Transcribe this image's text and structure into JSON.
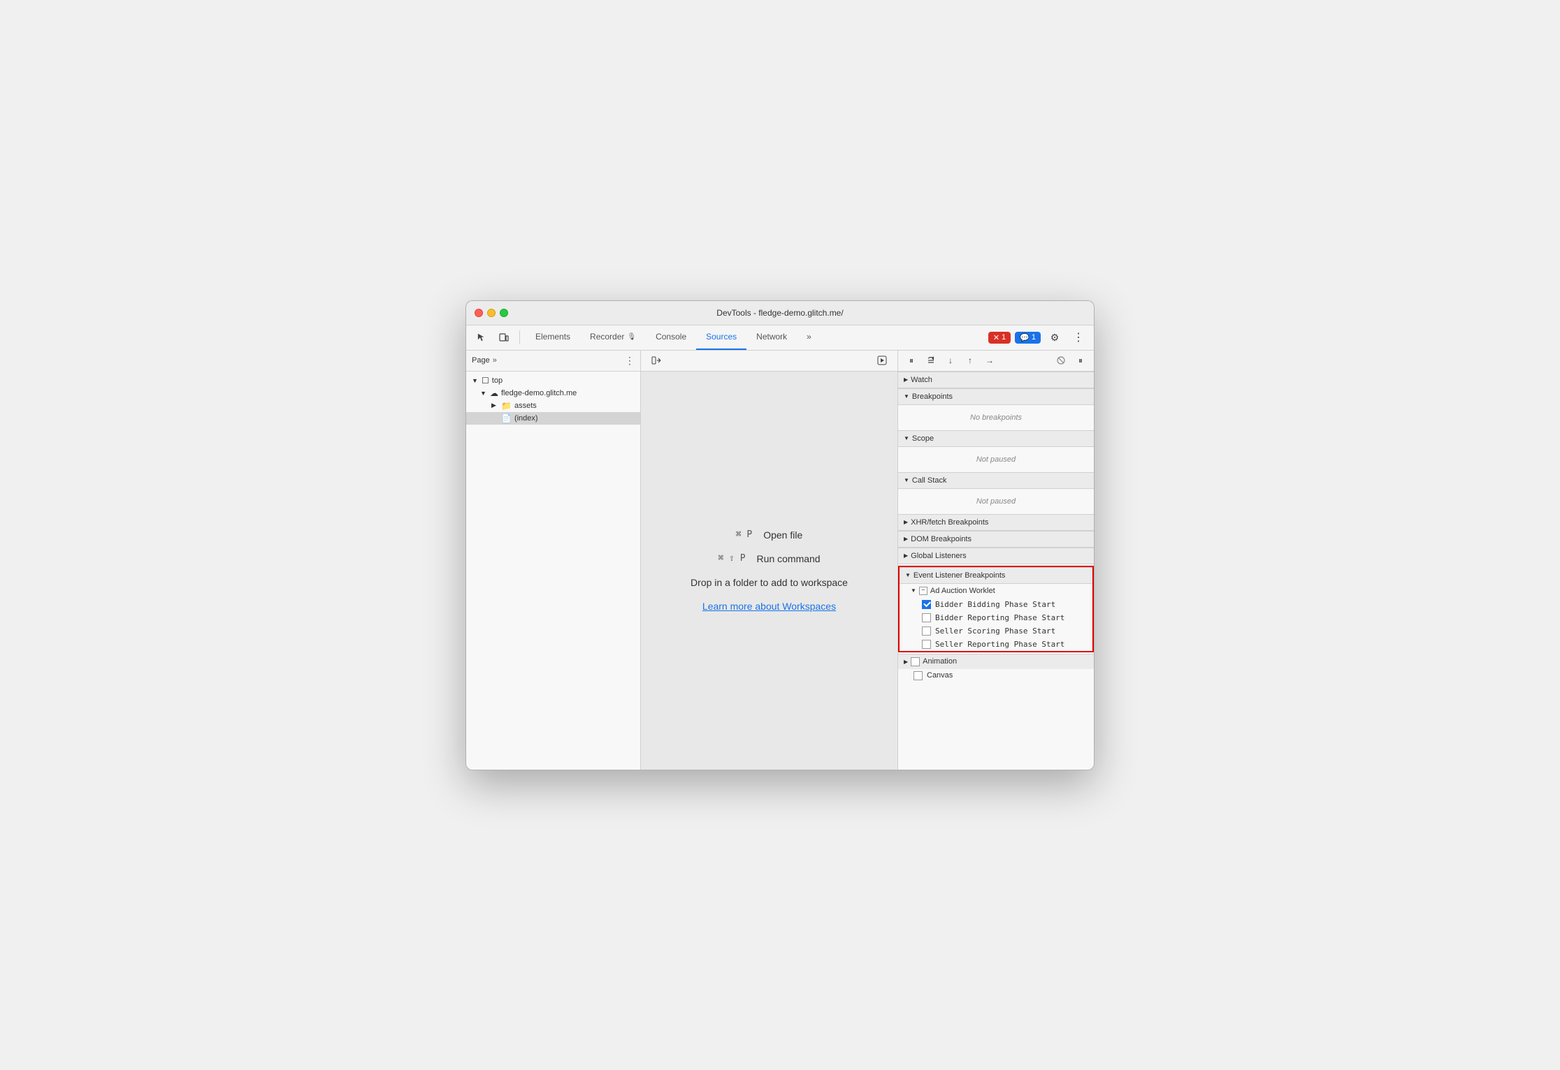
{
  "window": {
    "title": "DevTools - fledge-demo.glitch.me/"
  },
  "toolbar": {
    "tabs": [
      {
        "id": "elements",
        "label": "Elements",
        "active": false
      },
      {
        "id": "recorder",
        "label": "Recorder 🔴",
        "active": false
      },
      {
        "id": "console",
        "label": "Console",
        "active": false
      },
      {
        "id": "sources",
        "label": "Sources",
        "active": true
      },
      {
        "id": "network",
        "label": "Network",
        "active": false
      },
      {
        "id": "more",
        "label": "»",
        "active": false
      }
    ],
    "error_badge": "1",
    "info_badge": "1"
  },
  "file_panel": {
    "header": "Page",
    "tree": [
      {
        "id": "top",
        "label": "top",
        "indent": 0,
        "expanded": true,
        "icon": "▼"
      },
      {
        "id": "fledge",
        "label": "fledge-demo.glitch.me",
        "indent": 1,
        "expanded": true,
        "icon": "▼"
      },
      {
        "id": "assets",
        "label": "assets",
        "indent": 2,
        "expanded": false,
        "icon": "▶"
      },
      {
        "id": "index",
        "label": "(index)",
        "indent": 2,
        "expanded": false,
        "icon": "📄",
        "selected": true
      }
    ]
  },
  "center_panel": {
    "cmd1_shortcut": "⌘ P",
    "cmd1_label": "Open file",
    "cmd2_shortcut": "⌘ ⇧ P",
    "cmd2_label": "Run command",
    "workspace_text": "Drop in a folder to add to workspace",
    "workspace_link": "Learn more about Workspaces"
  },
  "right_panel": {
    "sections": [
      {
        "id": "watch",
        "label": "Watch",
        "expanded": false
      },
      {
        "id": "breakpoints",
        "label": "Breakpoints",
        "expanded": true,
        "empty_text": "No breakpoints"
      },
      {
        "id": "scope",
        "label": "Scope",
        "expanded": true,
        "empty_text": "Not paused"
      },
      {
        "id": "call_stack",
        "label": "Call Stack",
        "expanded": true,
        "empty_text": "Not paused"
      },
      {
        "id": "xhr",
        "label": "XHR/fetch Breakpoints",
        "expanded": false
      },
      {
        "id": "dom",
        "label": "DOM Breakpoints",
        "expanded": false
      },
      {
        "id": "global",
        "label": "Global Listeners",
        "expanded": false
      },
      {
        "id": "event_listener",
        "label": "Event Listener Breakpoints",
        "expanded": true,
        "highlighted": true
      }
    ],
    "event_listener": {
      "sub_sections": [
        {
          "id": "ad_auction",
          "label": "Ad Auction Worklet",
          "expanded": true,
          "items": [
            {
              "id": "bidder_bidding",
              "label": "Bidder Bidding Phase Start",
              "checked": true
            },
            {
              "id": "bidder_reporting",
              "label": "Bidder Reporting Phase Start",
              "checked": false
            },
            {
              "id": "seller_scoring",
              "label": "Seller Scoring Phase Start",
              "checked": false
            },
            {
              "id": "seller_reporting",
              "label": "Seller Reporting Phase Start",
              "checked": false
            }
          ]
        }
      ],
      "animation_label": "Animation",
      "canvas_label": "Canvas"
    }
  }
}
